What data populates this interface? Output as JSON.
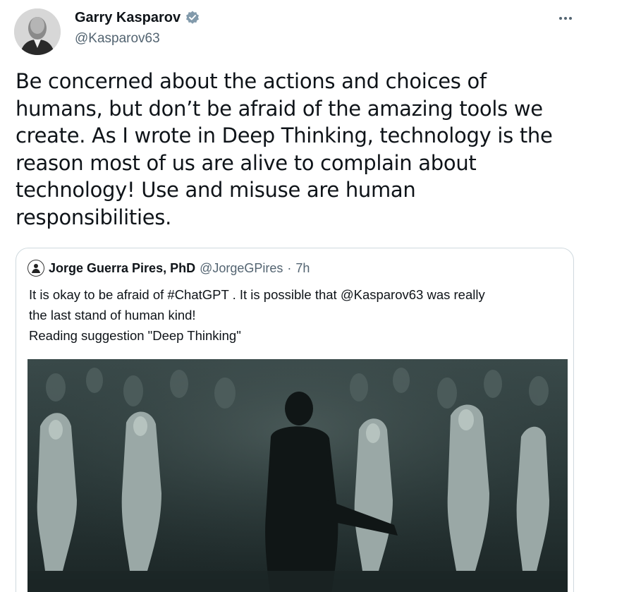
{
  "author": {
    "name": "Garry Kasparov",
    "handle": "@Kasparov63",
    "verified": true,
    "avatar_icon": "profile-photo"
  },
  "more_icon": "more-options-icon",
  "tweet": {
    "lines": [
      "Be concerned about the actions and choices of",
      "humans, but don’t be afraid of the amazing tools we",
      "create. As I wrote in Deep Thinking, technology is the",
      "reason most of us are alive to complain about",
      "technology! Use and misuse are human",
      "responsibilities."
    ]
  },
  "quote": {
    "name": "Jorge Guerra Pires, PhD",
    "handle": "@JorgeGPires",
    "separator": "·",
    "time": "7h",
    "lines": [
      "It is okay to be afraid of #ChatGPT . It is possible that @Kasparov63 was really",
      "the last stand of human kind!",
      "Reading suggestion \"Deep Thinking\""
    ],
    "media_icon": "video-still-image"
  },
  "colors": {
    "text": "#0f1419",
    "secondary": "#536471",
    "border": "#cfd9de",
    "verified": "#829aab"
  }
}
